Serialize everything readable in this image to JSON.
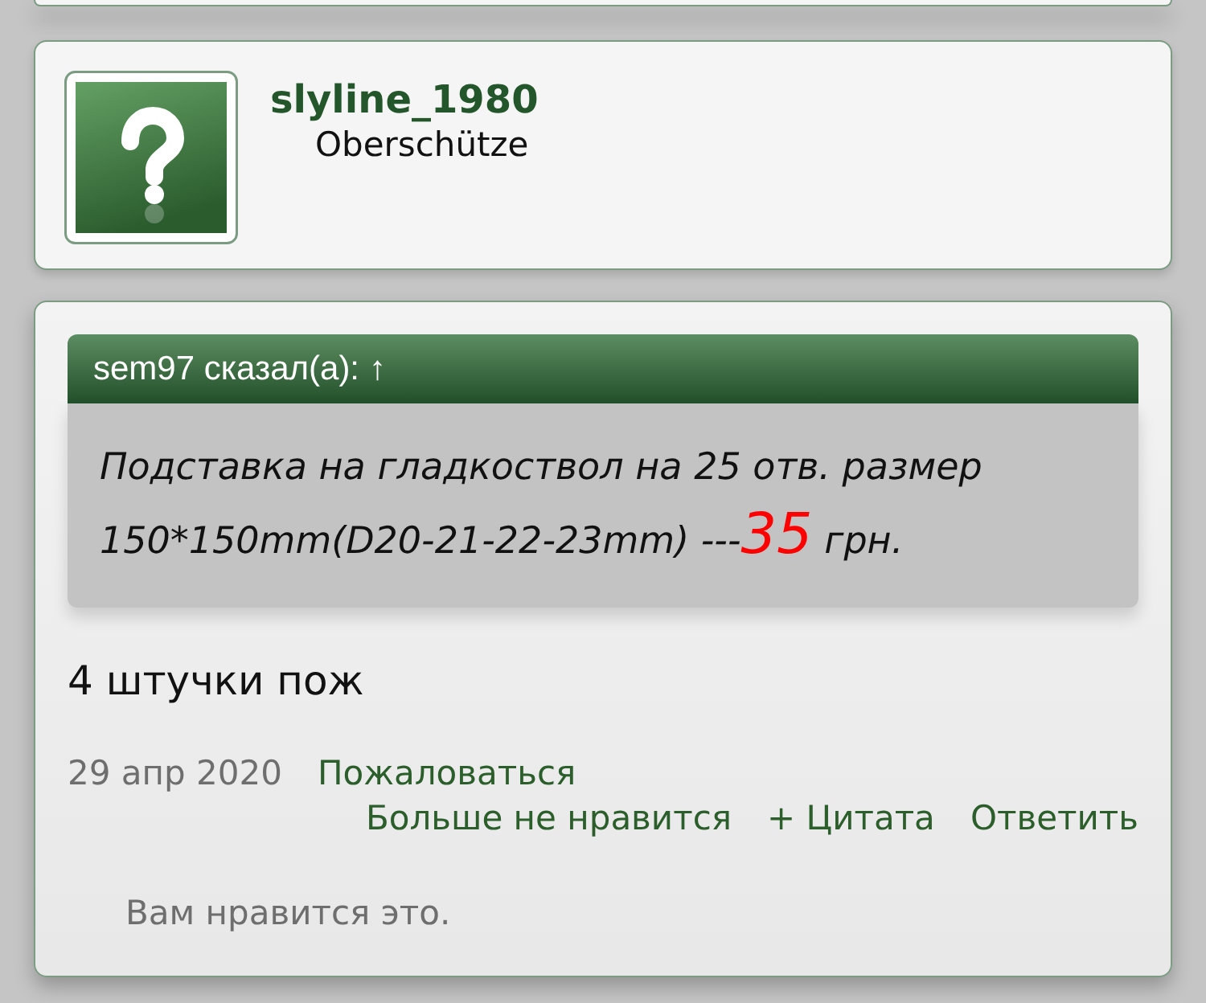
{
  "author": {
    "username": "slyline_1980",
    "title": "Oberschütze"
  },
  "quote": {
    "attribution": "sem97 сказал(а):",
    "jump_link": "↑",
    "body": [
      {
        "kind": "text",
        "text": "Подставка на гладкоствол на 25 отв. размер 150*150mm(D20-21-22-23mm) ---"
      },
      {
        "kind": "price",
        "text": "35"
      },
      {
        "kind": "text",
        "text": " грн."
      }
    ]
  },
  "message": "4 штучки пож",
  "meta": {
    "date": "29 апр 2020",
    "report_link": "Пожаловаться"
  },
  "actions": [
    "Больше не нравится",
    "+ Цитата",
    "Ответить"
  ],
  "likes_summary": "Вам нравится это."
}
